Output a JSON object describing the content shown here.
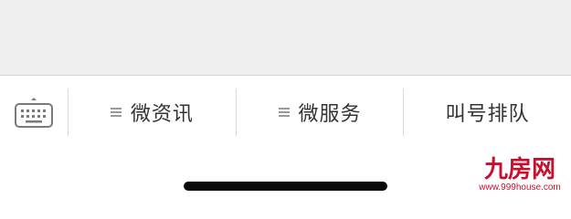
{
  "menu": {
    "items": [
      {
        "label": "微资讯",
        "icon": "menu-lines-icon"
      },
      {
        "label": "微服务",
        "icon": "menu-lines-icon"
      },
      {
        "label": "叫号排队"
      }
    ],
    "keyboard_icon": "keyboard-icon"
  },
  "watermark": {
    "logo_text": "九房网",
    "url": "www.999house.com"
  },
  "colors": {
    "top_area_bg": "#efefef",
    "menu_text": "#333333",
    "watermark": "#c8102e"
  }
}
